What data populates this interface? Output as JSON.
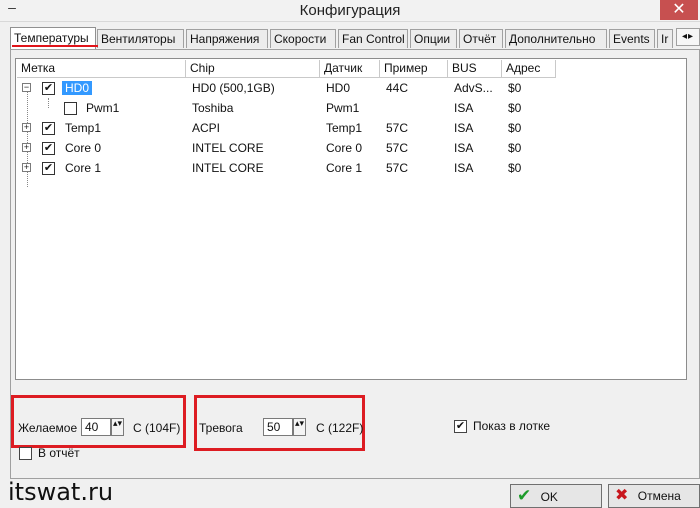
{
  "window": {
    "title": "Конфигурация",
    "minimize_glyph": "–",
    "close_glyph": "✕"
  },
  "tabs": [
    {
      "label": "Температуры",
      "active": true
    },
    {
      "label": "Вентиляторы"
    },
    {
      "label": "Напряжения"
    },
    {
      "label": "Скорости"
    },
    {
      "label": "Fan Control"
    },
    {
      "label": "Опции"
    },
    {
      "label": "Отчёт"
    },
    {
      "label": "Дополнительно"
    },
    {
      "label": "Events"
    },
    {
      "label": "Ir"
    }
  ],
  "tab_scroll": "◂▸",
  "columns": [
    "Метка",
    "Chip",
    "Датчик",
    "Пример",
    "BUS",
    "Адрес"
  ],
  "rows": [
    {
      "expander": "−",
      "checked": true,
      "label": "HD0",
      "chip": "HD0 (500,1GB)",
      "sensor": "HD0",
      "sample": "44C",
      "bus": "AdvS...",
      "addr": "$0",
      "check_mark": "✔"
    },
    {
      "expander": "",
      "checked": false,
      "label": "Pwm1",
      "chip": "Toshiba",
      "sensor": "Pwm1",
      "sample": "",
      "bus": "ISA",
      "addr": "$0",
      "check_mark": ""
    },
    {
      "expander": "+",
      "checked": true,
      "label": "Temp1",
      "chip": "ACPI",
      "sensor": "Temp1",
      "sample": "57C",
      "bus": "ISA",
      "addr": "$0",
      "check_mark": "✔"
    },
    {
      "expander": "+",
      "checked": true,
      "label": "Core 0",
      "chip": "INTEL CORE",
      "sensor": "Core 0",
      "sample": "57C",
      "bus": "ISA",
      "addr": "$0",
      "check_mark": "✔"
    },
    {
      "expander": "+",
      "checked": true,
      "label": "Core 1",
      "chip": "INTEL CORE",
      "sensor": "Core 1",
      "sample": "57C",
      "bus": "ISA",
      "addr": "$0",
      "check_mark": "✔"
    }
  ],
  "desired": {
    "label": "Желаемое",
    "value": "40",
    "unit": "C (104F)"
  },
  "alarm": {
    "label": "Тревога",
    "value": "50",
    "unit": "C (122F)"
  },
  "spin_glyph": "▴▾",
  "show_in_tray": {
    "label": "Показ в лотке",
    "checked": true,
    "mark": "✔"
  },
  "to_report": {
    "label": "В отчёт",
    "checked": false,
    "mark": ""
  },
  "watermark": "itswat.ru",
  "buttons": {
    "ok_icon": "✔",
    "ok_label": "OK",
    "cancel_icon": "✖",
    "cancel_label": "Отмена"
  },
  "colors": {
    "highlight_red": "#dd1c22",
    "selection_blue": "#3399ff",
    "ok_green": "#1c9b2a"
  }
}
